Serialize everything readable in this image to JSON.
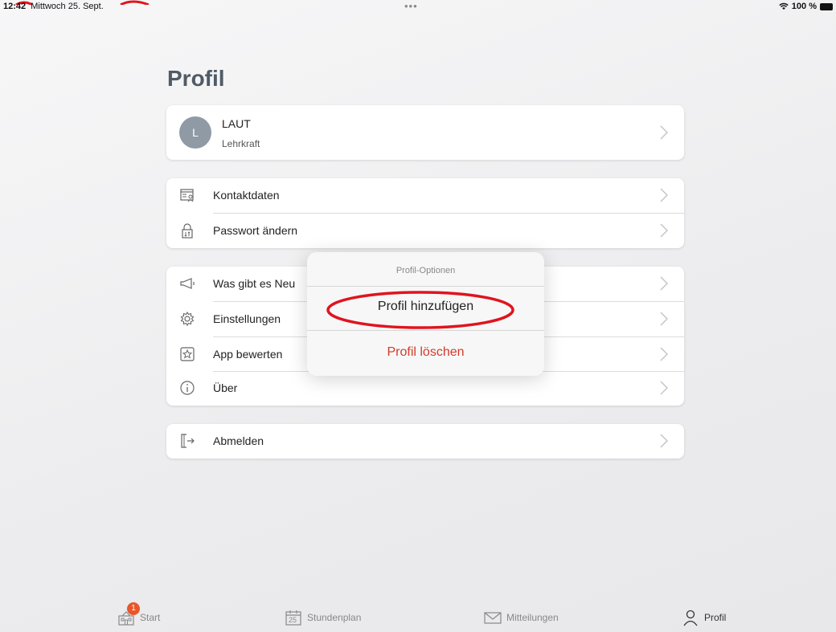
{
  "status_bar": {
    "time": "12:42",
    "date": "Mittwoch 25. Sept.",
    "dots": "•••",
    "battery": "100 %"
  },
  "page": {
    "title": "Profil"
  },
  "profile": {
    "initial": "L",
    "name": "LAUT",
    "role": "Lehrkraft"
  },
  "account_section": {
    "items": [
      {
        "label": "Kontaktdaten",
        "icon": "contact-card-icon"
      },
      {
        "label": "Passwort ändern",
        "icon": "lock-icon"
      }
    ]
  },
  "info_section": {
    "items": [
      {
        "label": "Was gibt es Neu",
        "icon": "megaphone-icon"
      },
      {
        "label": "Einstellungen",
        "icon": "gear-icon"
      },
      {
        "label": "App bewerten",
        "icon": "star-icon"
      },
      {
        "label": "Über",
        "icon": "info-icon"
      }
    ]
  },
  "logout_section": {
    "items": [
      {
        "label": "Abmelden",
        "icon": "logout-door-icon"
      }
    ]
  },
  "popover": {
    "title": "Profil-Optionen",
    "add_label": "Profil hinzufügen",
    "delete_label": "Profil löschen"
  },
  "tabbar": {
    "tabs": [
      {
        "label": "Start",
        "icon": "school-icon",
        "badge": "1"
      },
      {
        "label": "Stundenplan",
        "icon": "calendar-icon",
        "calendar_day": "25"
      },
      {
        "label": "Mitteilungen",
        "icon": "envelope-icon"
      },
      {
        "label": "Profil",
        "icon": "person-icon",
        "active": true
      }
    ]
  },
  "colors": {
    "title": "#505b66",
    "avatar": "#8f9aa5",
    "destructive": "#d43a2a",
    "highlight_ellipse": "#e0141e",
    "badge": "#e8562a"
  }
}
